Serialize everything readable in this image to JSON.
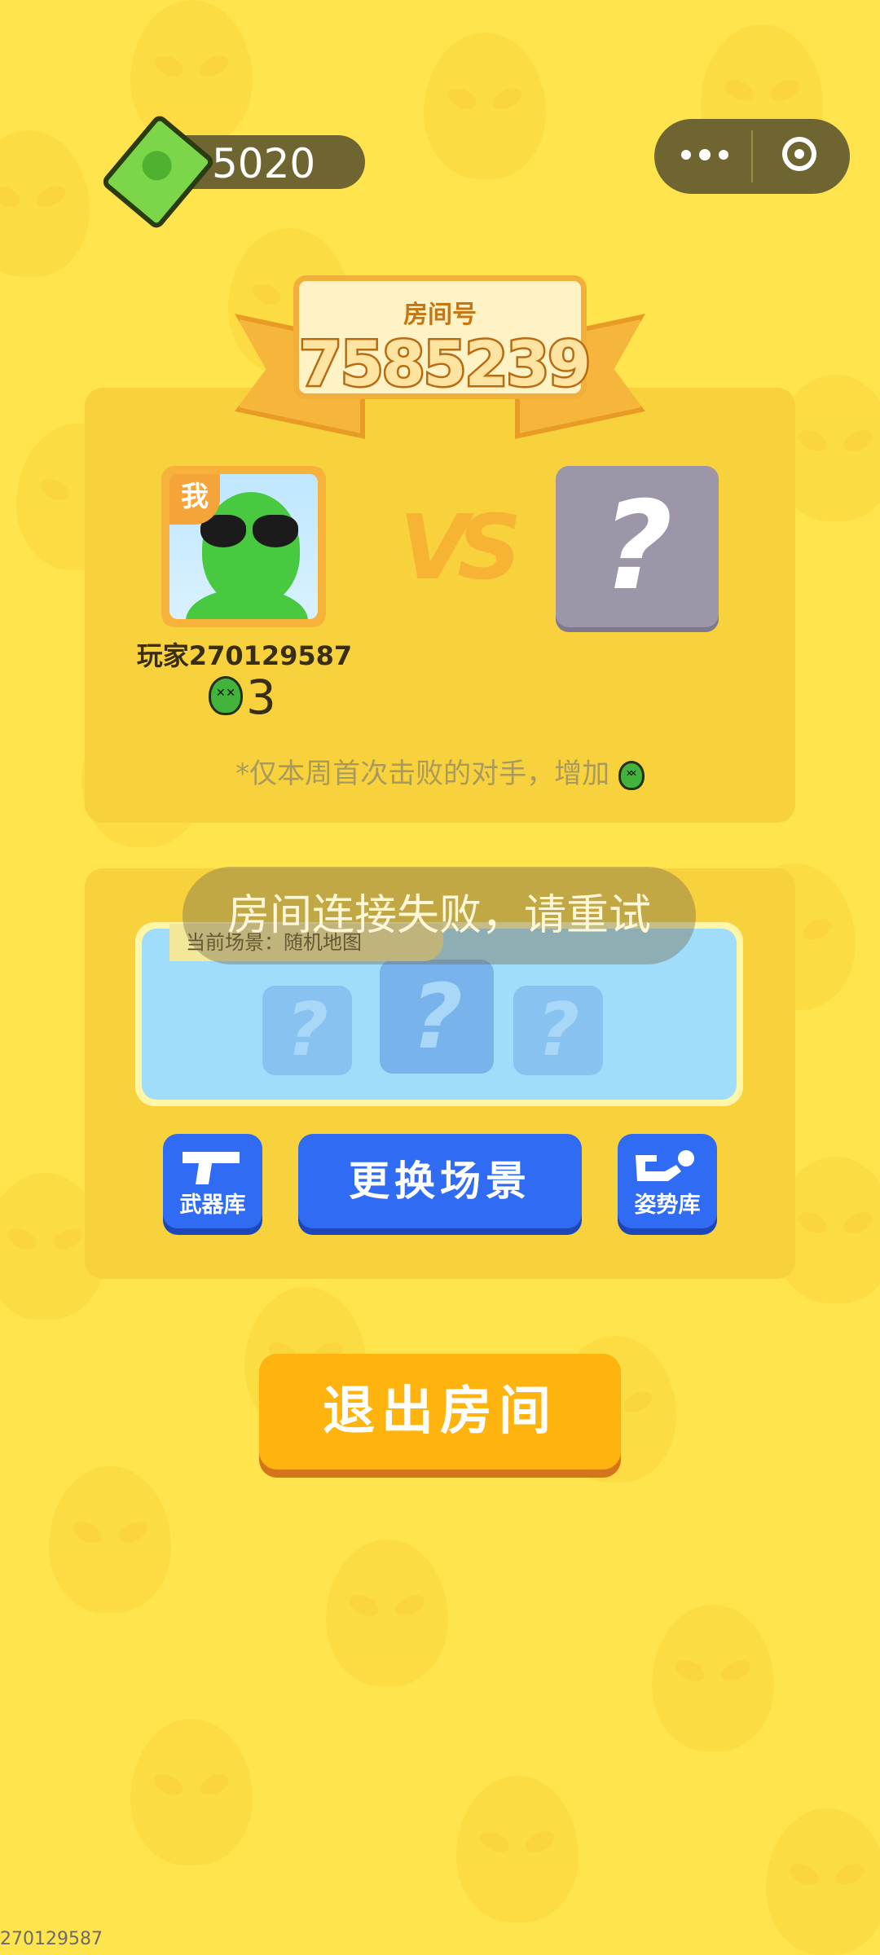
{
  "header": {
    "currency_value": "5020"
  },
  "room": {
    "label": "房间号",
    "number": "7585239"
  },
  "players": {
    "me": {
      "badge": "我",
      "name": "玩家270129587",
      "kills": "3"
    },
    "vs_text": "VS",
    "opponent": {
      "placeholder": "?"
    }
  },
  "note_text": "*仅本周首次击败的对手，增加",
  "scene": {
    "label": "当前场景：随机地图",
    "card_glyph": "?"
  },
  "toast": "房间连接失败，请重试",
  "buttons": {
    "weapons": "武器库",
    "change_scene": "更换场景",
    "poses": "姿势库",
    "exit_room": "退出房间"
  },
  "footer_id": "270129587",
  "colors": {
    "background": "#FFE44E",
    "blue_button": "#2F6BF3",
    "exit_button": "#FEB30F"
  }
}
